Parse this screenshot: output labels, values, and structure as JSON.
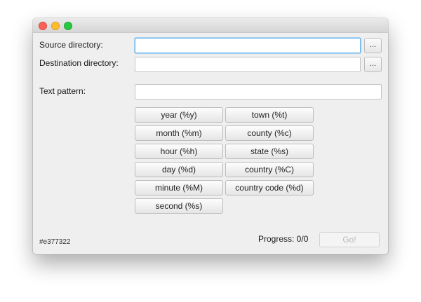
{
  "window": {
    "traffic_lights": [
      {
        "name": "close",
        "color": "#fc5f57"
      },
      {
        "name": "minimize",
        "color": "#fdbc2e"
      },
      {
        "name": "maximize",
        "color": "#28c840"
      }
    ]
  },
  "form": {
    "source_label": "Source directory:",
    "source_value": "",
    "source_browse": "...",
    "destination_label": "Destination directory:",
    "destination_value": "",
    "destination_browse": "...",
    "pattern_label": "Text pattern:",
    "pattern_value": ""
  },
  "tokens": {
    "left": [
      "year (%y)",
      "month (%m)",
      "hour (%h)",
      "day (%d)",
      "minute (%M)",
      "second (%s)"
    ],
    "right": [
      "town (%t)",
      "county (%c)",
      "state (%s)",
      "country (%C)",
      "country code (%d)"
    ]
  },
  "footer": {
    "color_code": "#e377322",
    "progress": "Progress: 0/0",
    "go_label": "Go!"
  },
  "colors": {
    "focus_ring": "#6fb5e8",
    "window_bg": "#efefef"
  }
}
